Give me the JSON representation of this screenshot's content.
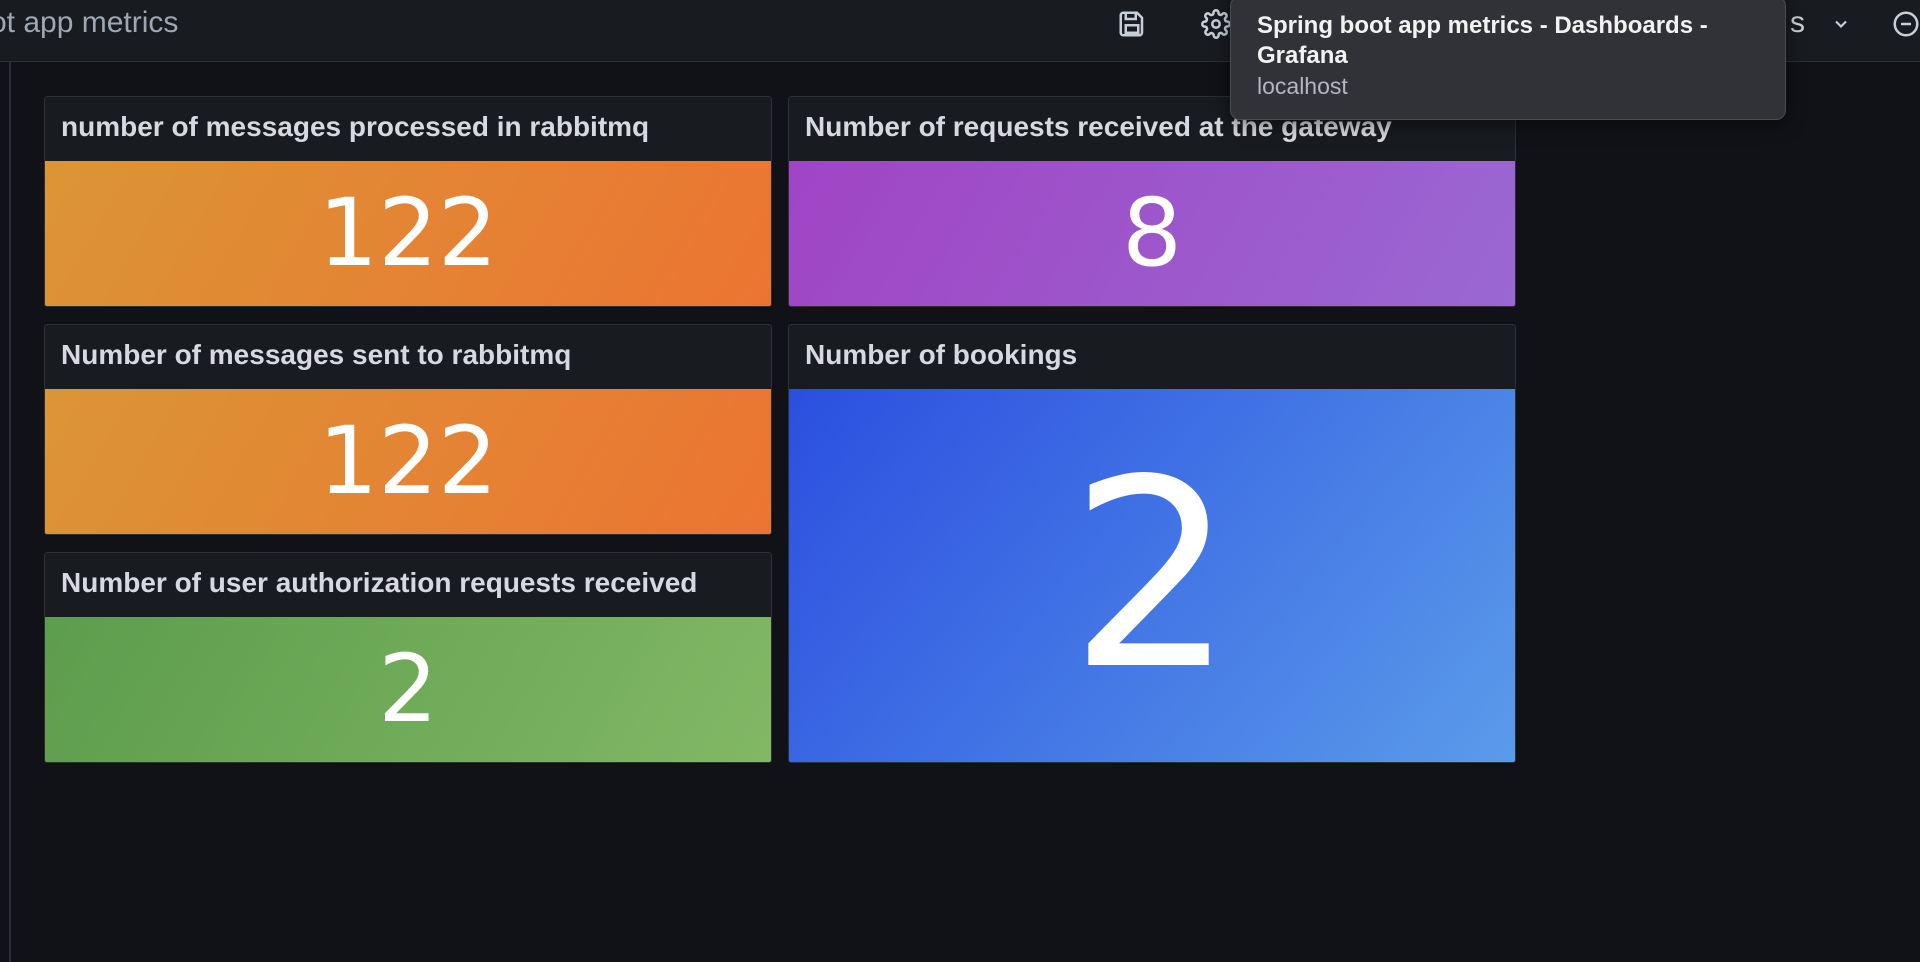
{
  "header": {
    "dashboard_title": "ot app metrics",
    "partial_label": "s"
  },
  "icons": {
    "save": "save-icon",
    "settings": "gear-icon",
    "dropdown": "chevron-down-icon",
    "zoom_out": "zoom-out-icon"
  },
  "tooltip": {
    "title": "Spring boot app metrics - Dashboards - Grafana",
    "subtitle": "localhost"
  },
  "panels": [
    {
      "title": "number of messages processed in rabbitmq",
      "value": "122",
      "color": "#e8823a"
    },
    {
      "title": "Number of requests received at the gateway",
      "value": "8",
      "color": "#9c56ca"
    },
    {
      "title": "Number of messages sent to rabbitmq",
      "value": "122",
      "color": "#e8823a"
    },
    {
      "title": "Number of bookings",
      "value": "2",
      "color": "#3a6fe4"
    },
    {
      "title": "Number of user authorization requests received",
      "value": "2",
      "color": "#6ea85a"
    }
  ]
}
